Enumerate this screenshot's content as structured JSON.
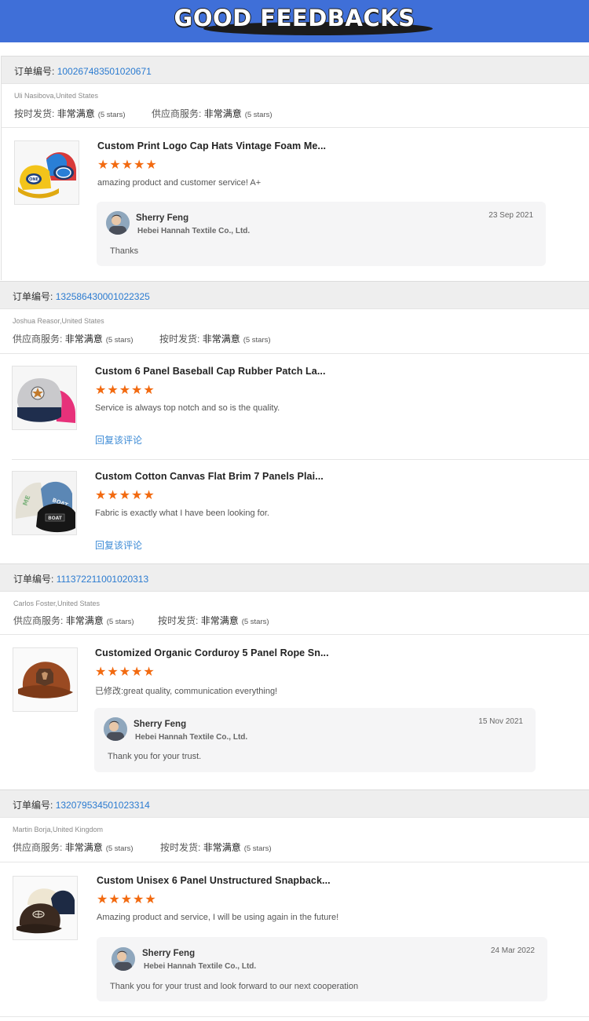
{
  "banner": {
    "title": "GOOD FEEDBACKS"
  },
  "colors": {
    "banner": "#3f6fd8",
    "stars": "#f26a10",
    "link": "#2b7bd0"
  },
  "order_label": "订单编号:",
  "reply_link_label": "回复该评论",
  "stars_text": "★★★★★",
  "orders": [
    {
      "order_no": "100267483501020671",
      "customer": "Uli Nasibova,United States",
      "ratings": [
        {
          "label": "按时发货:",
          "value": "非常满意",
          "stars": "(5 stars)"
        },
        {
          "label": "供应商服务:",
          "value": "非常满意",
          "stars": "(5 stars)"
        }
      ],
      "items": [
        {
          "title": "Custom Print Logo Cap Hats Vintage Foam Me...",
          "review": "amazing product and customer service! A+",
          "reply": {
            "name": "Sherry Feng",
            "company": "Hebei Hannah Textile Co., Ltd.",
            "date": "23 Sep 2021",
            "text": "Thanks"
          }
        }
      ]
    },
    {
      "order_no": "132586430001022325",
      "customer": "Joshua Reasor,United States",
      "ratings": [
        {
          "label": "供应商服务:",
          "value": "非常满意",
          "stars": "(5 stars)"
        },
        {
          "label": "按时发货:",
          "value": "非常满意",
          "stars": "(5 stars)"
        }
      ],
      "items": [
        {
          "title": "Custom 6 Panel Baseball Cap Rubber Patch La...",
          "review": "Service is always top notch and so is the quality."
        },
        {
          "title": "Custom Cotton Canvas Flat Brim 7 Panels Plai...",
          "review": "Fabric is exactly what I have been looking for."
        }
      ]
    },
    {
      "order_no": "111372211001020313",
      "customer": "Carlos Foster,United States",
      "ratings": [
        {
          "label": "供应商服务:",
          "value": "非常满意",
          "stars": "(5 stars)"
        },
        {
          "label": "按时发货:",
          "value": "非常满意",
          "stars": "(5 stars)"
        }
      ],
      "items": [
        {
          "title": "Customized Organic Corduroy 5 Panel Rope Sn...",
          "review": "已修改:great quality, communication everything!",
          "reply": {
            "name": "Sherry Feng",
            "company": "Hebei Hannah Textile Co., Ltd.",
            "date": "15 Nov 2021",
            "text": "Thank you for your trust."
          }
        }
      ]
    },
    {
      "order_no": "132079534501023314",
      "customer": "Martin Borja,United Kingdom",
      "ratings": [
        {
          "label": "供应商服务:",
          "value": "非常满意",
          "stars": "(5 stars)"
        },
        {
          "label": "按时发货:",
          "value": "非常满意",
          "stars": "(5 stars)"
        }
      ],
      "items": [
        {
          "title": "Custom Unisex 6 Panel Unstructured Snapback...",
          "review": "Amazing product and service, I will be using again in the future!",
          "reply": {
            "name": "Sherry Feng",
            "company": "Hebei Hannah Textile Co., Ltd.",
            "date": "24 Mar 2022",
            "text": "Thank you for your trust and look forward to our next cooperation"
          }
        }
      ]
    }
  ]
}
